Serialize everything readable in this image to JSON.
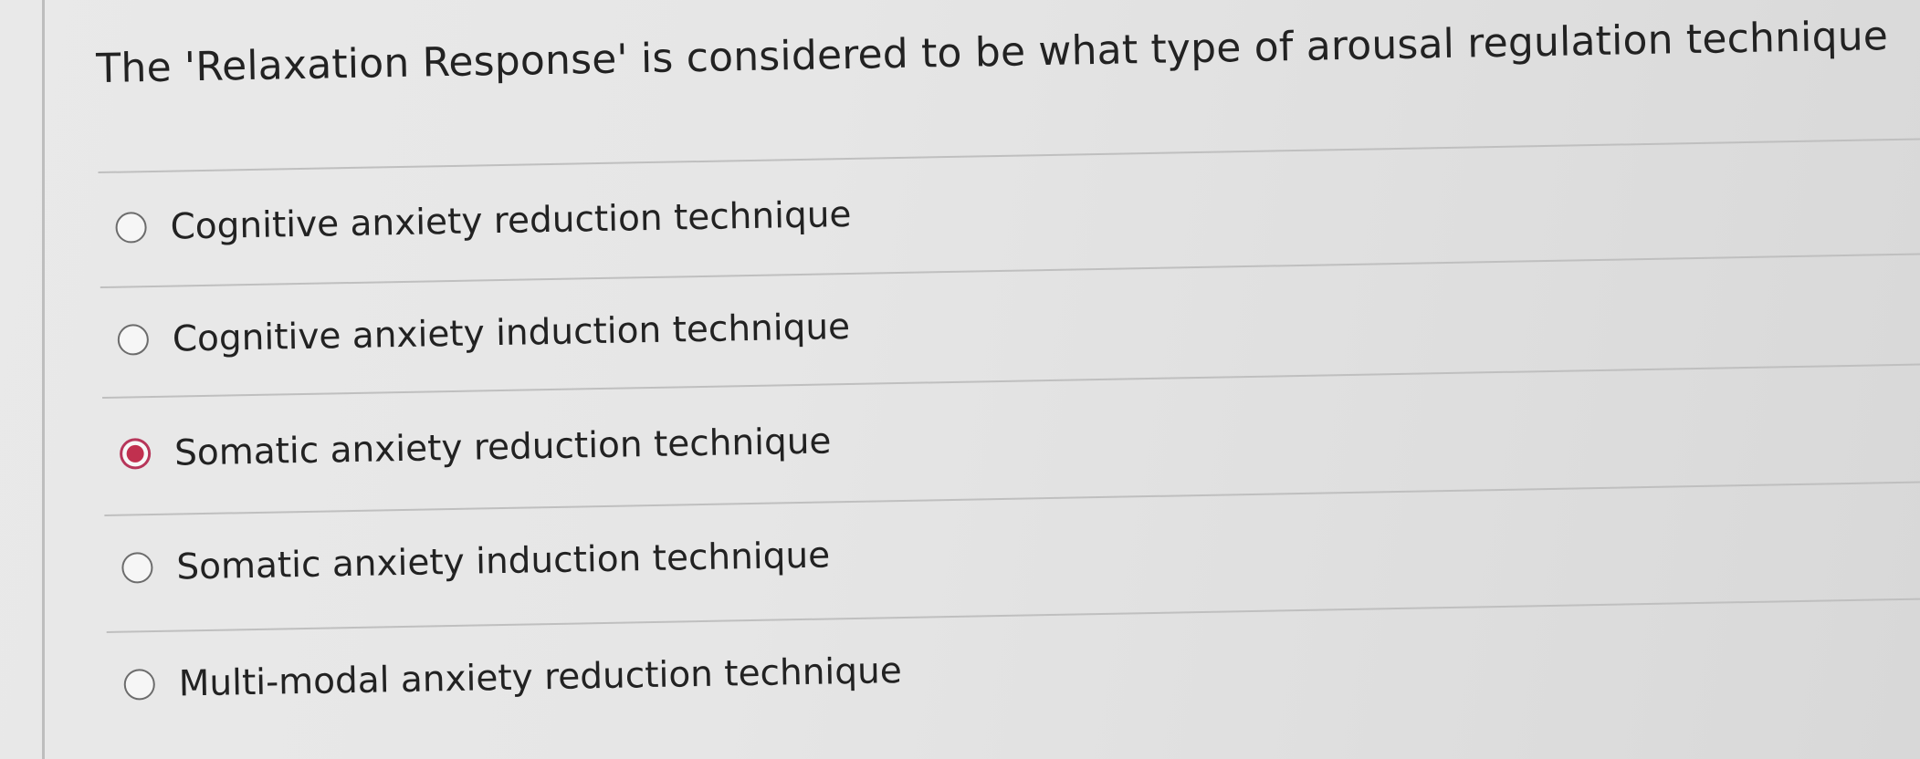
{
  "question": {
    "text": "The 'Relaxation Response' is considered to be what type of arousal regulation technique"
  },
  "options": [
    {
      "label": "Cognitive anxiety reduction technique",
      "selected": false
    },
    {
      "label": "Cognitive anxiety induction technique",
      "selected": false
    },
    {
      "label": "Somatic anxiety reduction technique",
      "selected": true
    },
    {
      "label": "Somatic anxiety induction technique",
      "selected": false
    },
    {
      "label": "Multi-modal anxiety reduction technique",
      "selected": false
    }
  ],
  "colors": {
    "selected_accent": "#c1304f",
    "text": "#222222",
    "divider": "#bfbfbf"
  }
}
